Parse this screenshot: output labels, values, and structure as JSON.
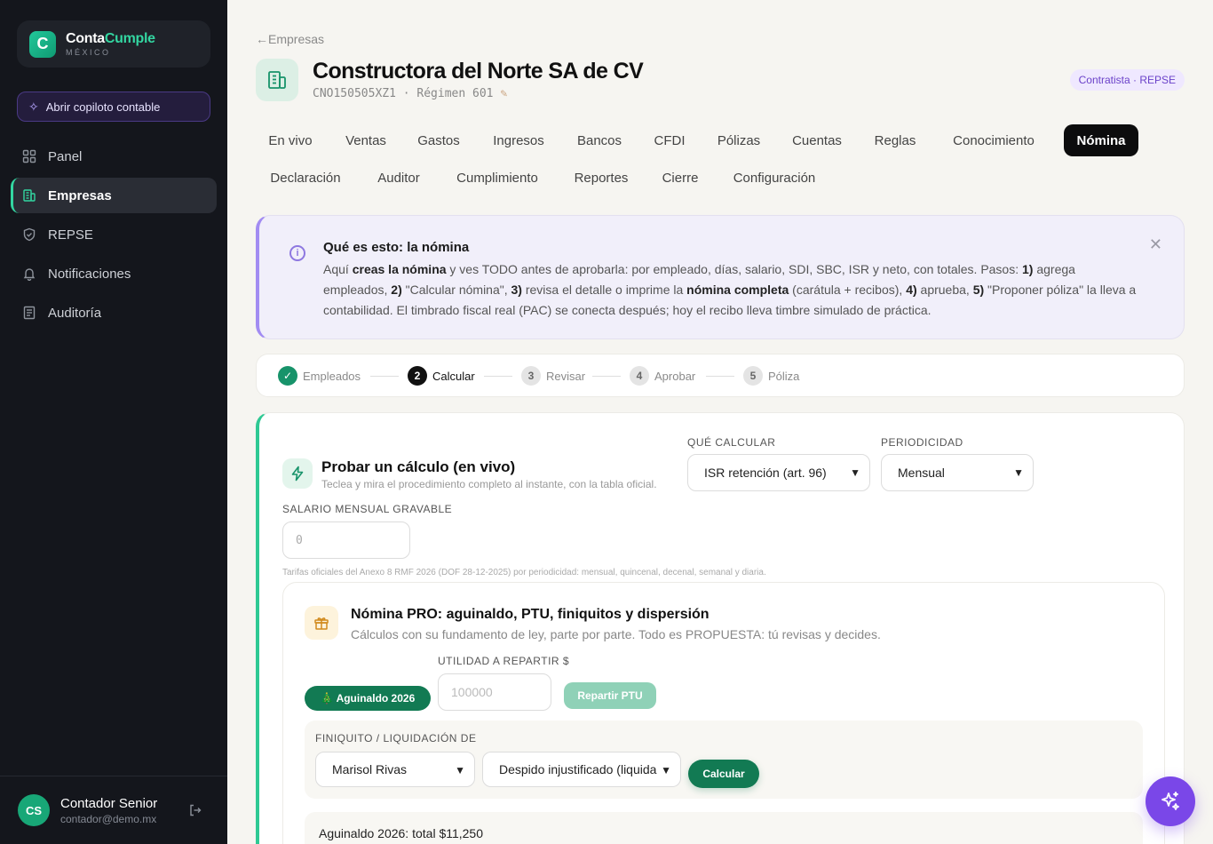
{
  "sidebar": {
    "logo": {
      "name_part1": "Conta",
      "name_part2": "Cumple",
      "sub": "MÉXICO"
    },
    "copilot_label": "Abrir copiloto contable",
    "items": [
      {
        "label": "Panel",
        "icon": "grid-icon"
      },
      {
        "label": "Empresas",
        "icon": "building-icon",
        "active": true
      },
      {
        "label": "REPSE",
        "icon": "shield-icon"
      },
      {
        "label": "Notificaciones",
        "icon": "bell-icon"
      },
      {
        "label": "Auditoría",
        "icon": "receipt-icon"
      }
    ],
    "user": {
      "initials": "CS",
      "name": "Contador Senior",
      "email": "contador@demo.mx"
    }
  },
  "header": {
    "back_label": "Empresas",
    "title": "Constructora del Norte SA de CV",
    "rfc": "CNO150505XZ1",
    "regimen": "Régimen 601",
    "badge": "Contratista · REPSE"
  },
  "tabs": [
    "En vivo",
    "Ventas",
    "Gastos",
    "Ingresos",
    "Bancos",
    "CFDI",
    "Pólizas",
    "Cuentas",
    "Reglas",
    "Conocimiento",
    "Nómina",
    "Declaración",
    "Auditor",
    "Cumplimiento",
    "Reportes",
    "Cierre",
    "Configuración"
  ],
  "active_tab": "Nómina",
  "info": {
    "title": "Qué es esto: la nómina",
    "p1": "Aquí ",
    "b1": "creas la nómina",
    "p2": " y ves TODO antes de aprobarla: por empleado, días, salario, SDI, SBC, ISR y neto, con totales. Pasos: ",
    "b2": "1)",
    "p3": " agrega empleados, ",
    "b3": "2)",
    "p4": " \"Calcular nómina\", ",
    "b4": "3)",
    "p5": " revisa el detalle o imprime la ",
    "b5": "nómina completa",
    "p6": " (carátula + recibos), ",
    "b6": "4)",
    "p7": " aprueba, ",
    "b7": "5)",
    "p8": " \"Proponer póliza\" la lleva a contabilidad. El timbrado fiscal real (PAC) se conecta después; hoy el recibo lleva timbre simulado de práctica."
  },
  "steps": [
    {
      "num": "✓",
      "label": "Empleados",
      "state": "done"
    },
    {
      "num": "2",
      "label": "Calcular",
      "state": "current"
    },
    {
      "num": "3",
      "label": "Revisar",
      "state": "pending"
    },
    {
      "num": "4",
      "label": "Aprobar",
      "state": "pending"
    },
    {
      "num": "5",
      "label": "Póliza",
      "state": "pending"
    }
  ],
  "calc": {
    "title": "Probar un cálculo (en vivo)",
    "subtitle": "Teclea y mira el procedimiento completo al instante, con la tabla oficial.",
    "que_label": "QUÉ CALCULAR",
    "que_value": "ISR retención (art. 96)",
    "periodo_label": "PERIODICIDAD",
    "periodo_value": "Mensual",
    "salario_label": "SALARIO MENSUAL GRAVABLE",
    "salario_placeholder": "0",
    "tarifas_note": "Tarifas oficiales del Anexo 8 RMF 2026 (DOF 28-12-2025) por periodicidad: mensual, quincenal, decenal, semanal y diaria."
  },
  "pro": {
    "title": "Nómina PRO: aguinaldo, PTU, finiquitos y dispersión",
    "subtitle": "Cálculos con su fundamento de ley, parte por parte. Todo es PROPUESTA: tú revisas y decides.",
    "aguinaldo_btn": "🎄 Aguinaldo 2026",
    "utilidad_label": "UTILIDAD A REPARTIR $",
    "utilidad_placeholder": "100000",
    "ptu_btn": "Repartir PTU",
    "finiquito_label": "FINIQUITO / LIQUIDACIÓN DE",
    "empleado_value": "Marisol Rivas",
    "motivo_value": "Despido injustificado (liquida",
    "calcular_btn": "Calcular",
    "aguinaldo_result": "Aguinaldo 2026: total $11,250"
  },
  "colors": {
    "brand": "#17936a",
    "accent": "#33d6a1",
    "purple": "#7a47e8"
  }
}
